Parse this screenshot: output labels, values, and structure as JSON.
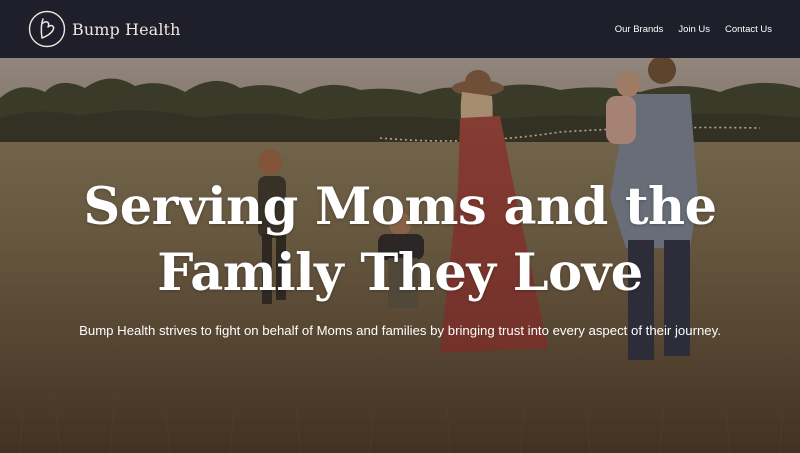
{
  "header": {
    "brand_name": "Bump Health",
    "logo_icon": "heart-b-logo-icon",
    "nav": [
      {
        "label": "Our Brands"
      },
      {
        "label": "Join Us"
      },
      {
        "label": "Contact Us"
      }
    ]
  },
  "hero": {
    "title_line1": "Serving Moms and the",
    "title_line2": "Family They Love",
    "subtitle": "Bump Health strives to fight on behalf of Moms and families by bringing trust into every aspect of their journey."
  },
  "colors": {
    "header_bg": "#1f1f2b",
    "brand_text": "#efe6dc",
    "hero_text": "#ffffff"
  }
}
